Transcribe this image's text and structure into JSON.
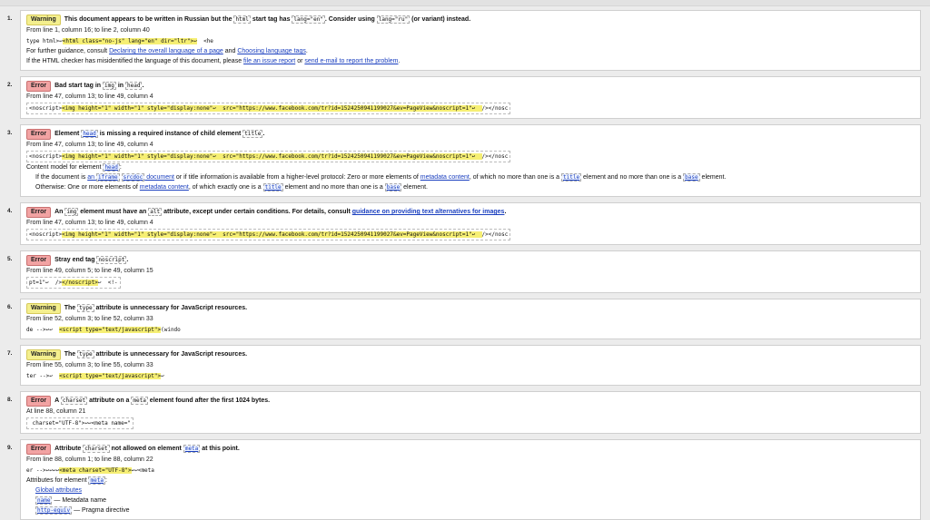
{
  "messages": [
    {
      "num": "1.",
      "type": "Warning",
      "head": [
        {
          "t": "This document appears to be written in Russian but the "
        },
        {
          "c": "html"
        },
        {
          "t": " start tag has "
        },
        {
          "c": "lang=\"en\""
        },
        {
          "t": ". Consider using "
        },
        {
          "c": "lang=\"ru\""
        },
        {
          "t": " (or variant) instead."
        }
      ],
      "location": "From line 1, column 16; to line 2, column 40",
      "extract_plain": true,
      "extract": [
        {
          "t": "type html>↩"
        },
        {
          "h": "<html class=\"no-js\" lang=\"en\" dir=\"ltr\">↩"
        },
        {
          "t": "  <he"
        }
      ],
      "extra": [
        {
          "parts": [
            {
              "t": "For further guidance, consult "
            },
            {
              "a": "Declaring the overall language of a page"
            },
            {
              "t": " and "
            },
            {
              "a": "Choosing language tags"
            },
            {
              "t": "."
            }
          ]
        },
        {
          "parts": [
            {
              "t": "If the HTML checker has misidentified the language of this document, please "
            },
            {
              "a": "file an issue report"
            },
            {
              "t": " or "
            },
            {
              "a": "send e-mail to report the problem"
            },
            {
              "t": "."
            }
          ]
        }
      ]
    },
    {
      "num": "2.",
      "type": "Error",
      "head": [
        {
          "t": "Bad start tag in "
        },
        {
          "c": "img"
        },
        {
          "t": " in "
        },
        {
          "c": "head"
        },
        {
          "t": "."
        }
      ],
      "location": "From line 47, column 13; to line 49, column 4",
      "extract": [
        {
          "t": "<noscript>"
        },
        {
          "h": "<img height=\"1\" width=\"1\" style=\"display:none\"↩  src=\"https://www.facebook.com/tr?id=1524250941199027&ev=PageView&noscript=1\"↩  "
        },
        {
          "t": "/></nosc"
        }
      ],
      "extra": []
    },
    {
      "num": "3.",
      "type": "Error",
      "head": [
        {
          "t": "Element "
        },
        {
          "ac": "head"
        },
        {
          "t": " is missing a required instance of child element "
        },
        {
          "c": "title"
        },
        {
          "t": "."
        }
      ],
      "location": "From line 47, column 13; to line 49, column 4",
      "extract": [
        {
          "t": "<noscript>"
        },
        {
          "h": "<img height=\"1\" width=\"1\" style=\"display:none\"↩  src=\"https://www.facebook.com/tr?id=1524250941199027&ev=PageView&noscript=1\"↩  "
        },
        {
          "t": "/></nosc"
        }
      ],
      "extra": [
        {
          "parts": [
            {
              "t": "Content model for element "
            },
            {
              "ac": "head"
            },
            {
              "t": ":"
            }
          ]
        },
        {
          "indent": true,
          "parts": [
            {
              "t": "If the document is "
            },
            {
              "a": "an "
            },
            {
              "ac": "iframe"
            },
            {
              "t": " "
            },
            {
              "ac": "srcdoc"
            },
            {
              "a": " document"
            },
            {
              "t": " or if title information is available from a higher-level protocol: Zero or more elements of "
            },
            {
              "a": "metadata content"
            },
            {
              "t": ", of which no more than one is a "
            },
            {
              "ac": "title"
            },
            {
              "t": " element and no more than one is a "
            },
            {
              "ac": "base"
            },
            {
              "t": " element."
            }
          ]
        },
        {
          "indent": true,
          "parts": [
            {
              "t": "Otherwise: One or more elements of "
            },
            {
              "a": "metadata content"
            },
            {
              "t": ", of which exactly one is a "
            },
            {
              "ac": "title"
            },
            {
              "t": " element and no more than one is a "
            },
            {
              "ac": "base"
            },
            {
              "t": " element."
            }
          ]
        }
      ]
    },
    {
      "num": "4.",
      "type": "Error",
      "head": [
        {
          "t": "An "
        },
        {
          "c": "img"
        },
        {
          "t": " element must have an "
        },
        {
          "c": "alt"
        },
        {
          "t": " attribute, except under certain conditions. For details, consult "
        },
        {
          "a": "guidance on providing text alternatives for images"
        },
        {
          "t": "."
        }
      ],
      "location": "From line 47, column 13; to line 49, column 4",
      "extract": [
        {
          "t": "<noscript>"
        },
        {
          "h": "<img height=\"1\" width=\"1\" style=\"display:none\"↩  src=\"https://www.facebook.com/tr?id=1524250941199027&ev=PageView&noscript=1\"↩  "
        },
        {
          "t": "/></nosc"
        }
      ],
      "extra": []
    },
    {
      "num": "5.",
      "type": "Error",
      "head": [
        {
          "t": "Stray end tag "
        },
        {
          "c": "noscript"
        },
        {
          "t": "."
        }
      ],
      "location": "From line 49, column 5; to line 49, column 15",
      "extract": [
        {
          "t": "pt=1\"↩  />"
        },
        {
          "h": "</noscript>"
        },
        {
          "t": "↩  <!-"
        }
      ],
      "extra": []
    },
    {
      "num": "6.",
      "type": "Warning",
      "head": [
        {
          "t": "The "
        },
        {
          "c": "type"
        },
        {
          "t": " attribute is unnecessary for JavaScript resources."
        }
      ],
      "location": "From line 52, column 3; to line 52, column 33",
      "extract_plain": true,
      "extract": [
        {
          "t": "de -->↩↩  "
        },
        {
          "h": "<script type=\"text/javascript\">"
        },
        {
          "t": "(windo"
        }
      ],
      "extra": []
    },
    {
      "num": "7.",
      "type": "Warning",
      "head": [
        {
          "t": "The "
        },
        {
          "c": "type"
        },
        {
          "t": " attribute is unnecessary for JavaScript resources."
        }
      ],
      "location": "From line 55, column 3; to line 55, column 33",
      "extract_plain": true,
      "extract": [
        {
          "t": "ter -->↩  "
        },
        {
          "h": "<script type=\"text/javascript\">"
        },
        {
          "t": "↩"
        }
      ],
      "extra": []
    },
    {
      "num": "8.",
      "type": "Error",
      "head": [
        {
          "t": "A "
        },
        {
          "c": "charset"
        },
        {
          "t": " attribute on a "
        },
        {
          "c": "meta"
        },
        {
          "t": " element found after the first 1024 bytes."
        }
      ],
      "location": "At line 88, column 21",
      "extract": [
        {
          "t": " charset=\"UTF-8\">"
        },
        {
          "t": "↩↩<meta name=\""
        }
      ],
      "extra": []
    },
    {
      "num": "9.",
      "type": "Error",
      "head": [
        {
          "t": "Attribute "
        },
        {
          "c": "charset"
        },
        {
          "t": " not allowed on element "
        },
        {
          "ac": "meta"
        },
        {
          "t": " at this point."
        }
      ],
      "location": "From line 88, column 1; to line 88, column 22",
      "extract_plain": true,
      "extract": [
        {
          "t": "er -->↩↩↩↩"
        },
        {
          "h": "<meta charset=\"UTF-8\">"
        },
        {
          "t": "↩↩<meta"
        }
      ],
      "extra": [
        {
          "parts": [
            {
              "t": "Attributes for element "
            },
            {
              "ac": "meta"
            },
            {
              "t": ":"
            }
          ]
        },
        {
          "indent": true,
          "parts": [
            {
              "a": "Global attributes"
            }
          ]
        },
        {
          "indent": true,
          "parts": [
            {
              "ac": "name"
            },
            {
              "t": " — Metadata name"
            }
          ]
        },
        {
          "indent": true,
          "parts": [
            {
              "ac": "http-equiv"
            },
            {
              "t": " — Pragma directive"
            }
          ]
        }
      ]
    }
  ]
}
